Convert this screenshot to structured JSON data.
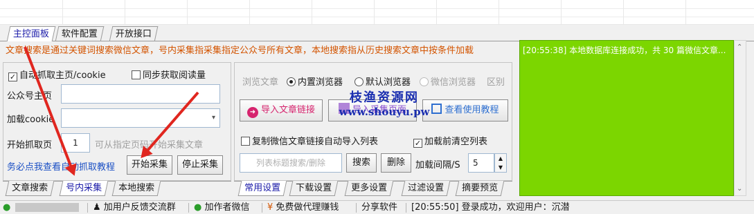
{
  "main_tabs": [
    "主控面板",
    "软件配置",
    "开放接口"
  ],
  "info_text": "文章搜索是通过关键词搜索微信文章，号内采集指采集指定公众号所有文章，本地搜索指从历史搜索文章中按条件加载",
  "left": {
    "auto_fetch_label": "自动抓取主页/cookie",
    "auto_fetch_checked": true,
    "sync_read_label": "同步获取阅读量",
    "sync_read_checked": false,
    "homepage_label": "公众号主页",
    "homepage_value": "",
    "cookie_label": "加载cookie",
    "cookie_value": "",
    "start_page_label": "开始抓取页",
    "start_page_value": "1",
    "start_page_hint": "可从指定页码开始采集文章",
    "tutorial_link": "务必点我查看自动抓取教程",
    "start_button": "开始采集",
    "stop_button": "停止采集",
    "bottom_tabs": [
      "文章搜索",
      "号内采集",
      "本地搜索"
    ]
  },
  "middle": {
    "browse_label": "浏览文章",
    "browsers": [
      {
        "label": "内置浏览器",
        "selected": true,
        "enabled": true
      },
      {
        "label": "默认浏览器",
        "selected": false,
        "enabled": true
      },
      {
        "label": "微信浏览器",
        "selected": false,
        "enabled": false
      }
    ],
    "distinguish_label": "区别",
    "import_link_button": "导入文章链接",
    "import_page_button": "导入采集页面",
    "usage_tutorial_button": "查看使用教程",
    "copy_link_label": "复制微信文章链接自动导入列表",
    "copy_link_checked": false,
    "clear_list_label": "加载前清空列表",
    "clear_list_checked": true,
    "search_placeholder": "列表标题搜索/删除",
    "search_button": "搜索",
    "delete_button": "删除",
    "interval_label": "加载间隔/S",
    "interval_value": "5",
    "bottom_tabs": [
      "常用设置",
      "下载设置",
      "更多设置",
      "过滤设置",
      "摘要预览"
    ]
  },
  "log": {
    "text": "[20:55:38] 本地数据库连接成功，共 30 篇微信文章..."
  },
  "watermark": {
    "line1": "枝渔资源网",
    "line2": "www.shouyu.pw"
  },
  "statusbar": {
    "feedback": "加用户反馈交流群",
    "author": "加作者微信",
    "proxy": "免费做代理赚钱",
    "share": "分享软件",
    "status": "[20:55:50] 登录成功，欢迎用户：沉潜"
  },
  "colors": {
    "info_text": "#d35400",
    "log_bg": "#7cd600",
    "link": "#1a4fc4",
    "arrow": "#e0261f",
    "accent_pink": "#d6246e",
    "accent_blue": "#2e6fd0"
  }
}
